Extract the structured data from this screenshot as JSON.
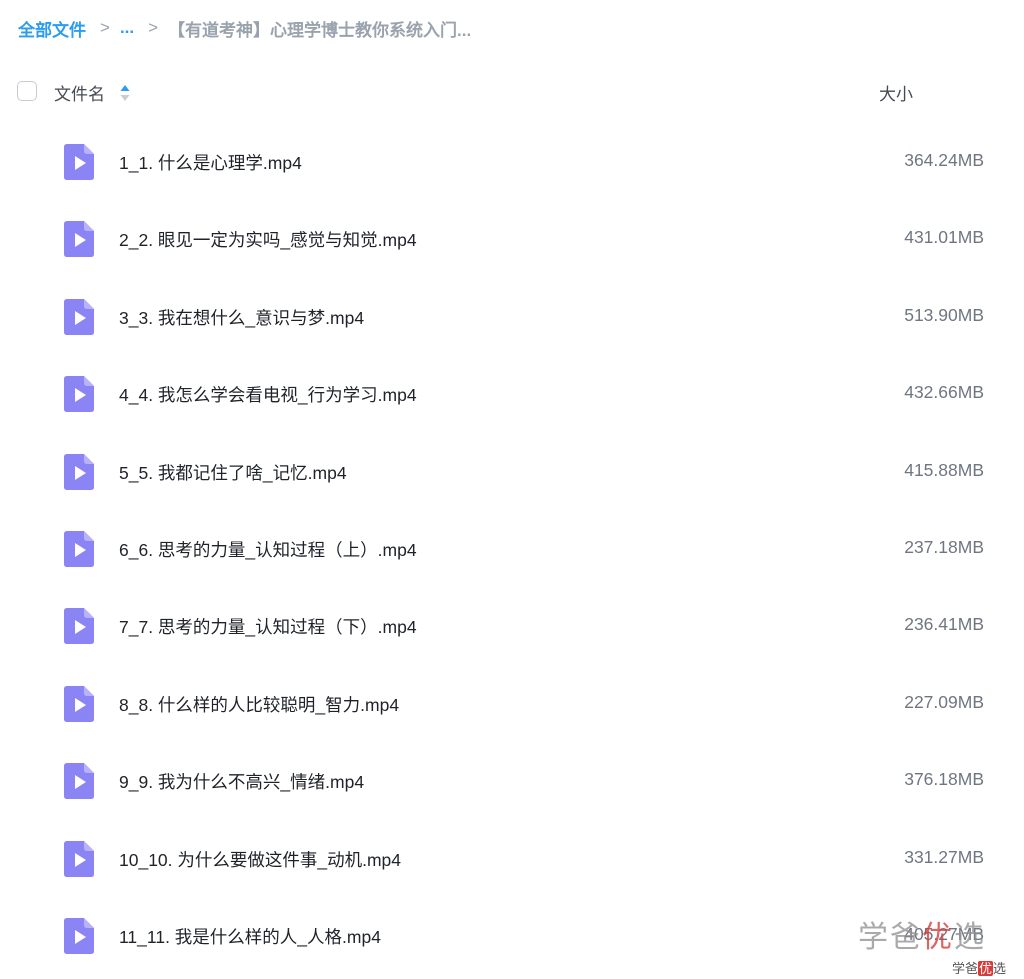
{
  "breadcrumb": {
    "root": "全部文件",
    "ellipsis": "...",
    "current": "【有道考神】心理学博士教你系统入门..."
  },
  "header": {
    "name_label": "文件名",
    "size_label": "大小"
  },
  "files": [
    {
      "name": "1_1. 什么是心理学.mp4",
      "size": "364.24MB"
    },
    {
      "name": "2_2. 眼见一定为实吗_感觉与知觉.mp4",
      "size": "431.01MB"
    },
    {
      "name": "3_3. 我在想什么_意识与梦.mp4",
      "size": "513.90MB"
    },
    {
      "name": "4_4. 我怎么学会看电视_行为学习.mp4",
      "size": "432.66MB"
    },
    {
      "name": "5_5. 我都记住了啥_记忆.mp4",
      "size": "415.88MB"
    },
    {
      "name": "6_6. 思考的力量_认知过程（上）.mp4",
      "size": "237.18MB"
    },
    {
      "name": "7_7. 思考的力量_认知过程（下）.mp4",
      "size": "236.41MB"
    },
    {
      "name": "8_8. 什么样的人比较聪明_智力.mp4",
      "size": "227.09MB"
    },
    {
      "name": "9_9. 我为什么不高兴_情绪.mp4",
      "size": "376.18MB"
    },
    {
      "name": "10_10. 为什么要做这件事_动机.mp4",
      "size": "331.27MB"
    },
    {
      "name": "11_11. 我是什么样的人_人格.mp4",
      "size": "405.27MB"
    }
  ],
  "watermark": {
    "large_a": "学爸",
    "large_hl": "优",
    "large_b": "选",
    "small_a": "学爸",
    "small_hl": "优",
    "small_b": "选"
  },
  "colors": {
    "accent": "#2b9cf2",
    "file_icon": "#8b84f5"
  }
}
